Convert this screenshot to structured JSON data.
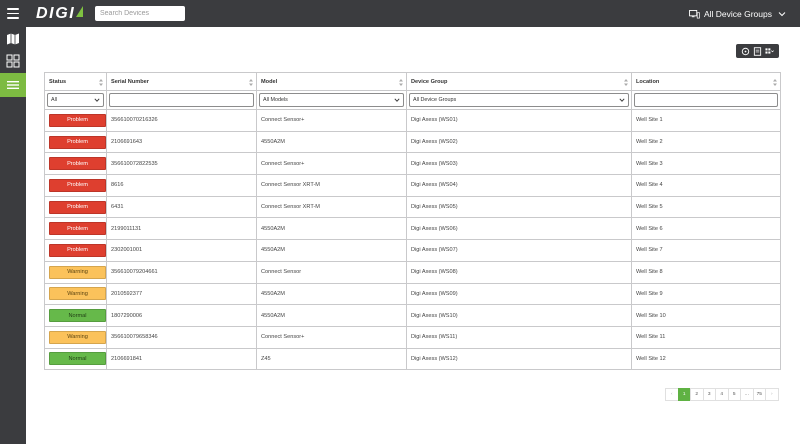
{
  "header": {
    "logo_text": "DIGI",
    "search_placeholder": "Search Devices",
    "group_selector_label": "All Device Groups"
  },
  "sidebar": {
    "items": [
      {
        "name": "map-icon",
        "active": false
      },
      {
        "name": "dashboard-icon",
        "active": false
      },
      {
        "name": "list-icon",
        "active": true
      }
    ]
  },
  "table": {
    "columns": [
      "Status",
      "Serial Number",
      "Model",
      "Device Group",
      "Location"
    ],
    "filters": {
      "status": "All",
      "serial": "",
      "model": "All Models",
      "group": "All Device Groups",
      "location": ""
    },
    "rows": [
      {
        "status": "Problem",
        "serial": "356610070216326",
        "model": "Connect Sensor+",
        "group": "Digi Axess (WS01)",
        "location": "Well Site 1"
      },
      {
        "status": "Problem",
        "serial": "2106691643",
        "model": "4550A2M",
        "group": "Digi Axess (WS02)",
        "location": "Well Site 2"
      },
      {
        "status": "Problem",
        "serial": "356610072822535",
        "model": "Connect Sensor+",
        "group": "Digi Axess (WS03)",
        "location": "Well Site 3"
      },
      {
        "status": "Problem",
        "serial": "8616",
        "model": "Connect Sensor XRT-M",
        "group": "Digi Axess (WS04)",
        "location": "Well Site 4"
      },
      {
        "status": "Problem",
        "serial": "6431",
        "model": "Connect Sensor XRT-M",
        "group": "Digi Axess (WS05)",
        "location": "Well Site 5"
      },
      {
        "status": "Problem",
        "serial": "2199011131",
        "model": "4550A2M",
        "group": "Digi Axess (WS06)",
        "location": "Well Site 6"
      },
      {
        "status": "Problem",
        "serial": "2302001001",
        "model": "4550A2M",
        "group": "Digi Axess (WS07)",
        "location": "Well Site 7"
      },
      {
        "status": "Warning",
        "serial": "356610079204661",
        "model": "Connect Sensor",
        "group": "Digi Axess (WS08)",
        "location": "Well Site 8"
      },
      {
        "status": "Warning",
        "serial": "2010592377",
        "model": "4550A2M",
        "group": "Digi Axess (WS09)",
        "location": "Well Site 9"
      },
      {
        "status": "Normal",
        "serial": "1807290006",
        "model": "4550A2M",
        "group": "Digi Axess (WS10)",
        "location": "Well Site 10"
      },
      {
        "status": "Warning",
        "serial": "356610079658346",
        "model": "Connect Sensor+",
        "group": "Digi Axess (WS11)",
        "location": "Well Site 11"
      },
      {
        "status": "Normal",
        "serial": "2106691841",
        "model": "Z45",
        "group": "Digi Axess (WS12)",
        "location": "Well Site 12"
      }
    ]
  },
  "pagination": {
    "prev": "‹",
    "pages": [
      "1",
      "2",
      "3",
      "4",
      "5",
      "…",
      "75"
    ],
    "current": "1",
    "next": "›"
  },
  "colors": {
    "topbar": "#3b3c3f",
    "accent_green": "#7dbb42",
    "problem": "#de3f2f",
    "warning": "#fbc25b",
    "normal": "#66b94a"
  }
}
